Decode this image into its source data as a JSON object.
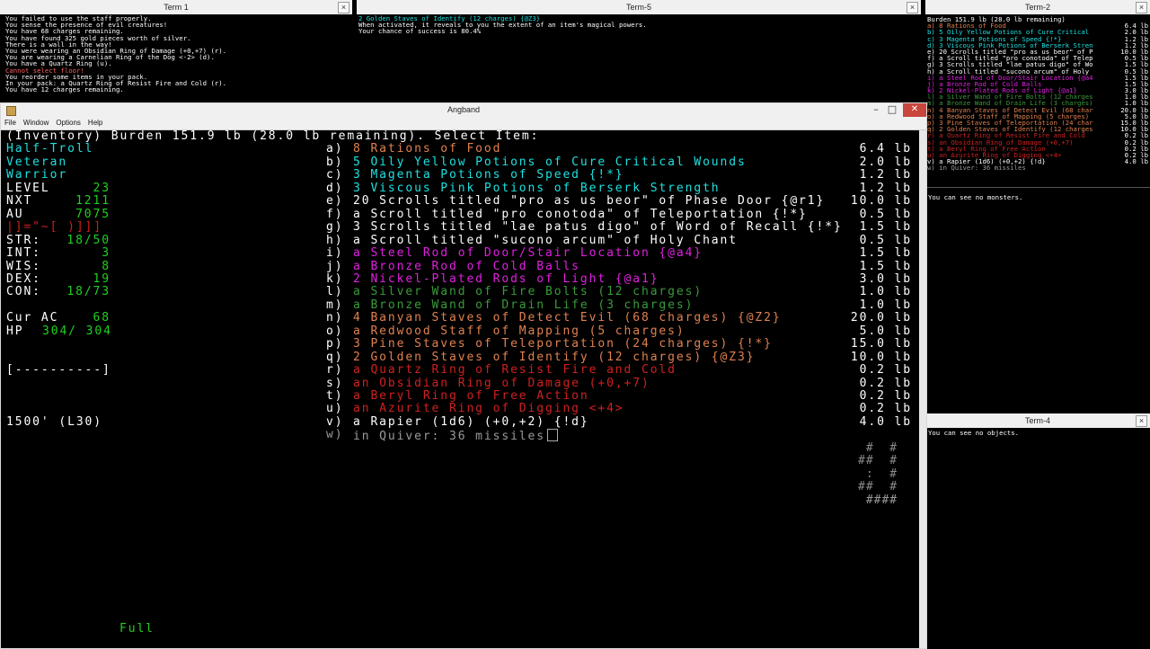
{
  "term1": {
    "title": "Term 1",
    "lines": [
      {
        "text": "You failed to use the staff properly.",
        "color": "#ffffff"
      },
      {
        "text": "You sense the presence of evil creatures!",
        "color": "#ffffff"
      },
      {
        "text": "You have 68 charges remaining.",
        "color": "#ffffff"
      },
      {
        "text": "You have found 325 gold pieces worth of silver.",
        "color": "#ffffff"
      },
      {
        "text": "There is a wall in the way!",
        "color": "#ffffff"
      },
      {
        "text": "You were wearing an Obsidian Ring of Damage (+0,+7) (r).",
        "color": "#ffffff"
      },
      {
        "text": "You are wearing a Carnelian Ring of the Dog <-2> (d).",
        "color": "#ffffff"
      },
      {
        "text": "You have a Quartz Ring (u).",
        "color": "#ffffff"
      },
      {
        "text": "Cannot select floor!",
        "color": "#ff6060"
      },
      {
        "text": "You reorder some items in your pack.",
        "color": "#ffffff"
      },
      {
        "text": "In your pack: a Quartz Ring of Resist Fire and Cold (r).",
        "color": "#ffffff"
      },
      {
        "text": "You have 12 charges remaining.",
        "color": "#ffffff"
      }
    ]
  },
  "term5": {
    "title": "Term-5",
    "lines": [
      {
        "text": "2 Golden Staves of Identify (12 charges) {@Z3}",
        "color": "#1ee0e0"
      },
      {
        "text": "When activated, it reveals to you the extent of an item's magical powers.",
        "color": "#ffffff"
      },
      {
        "text": "Your chance of success is 80.4%",
        "color": "#ffffff"
      }
    ]
  },
  "term2": {
    "title": "Term-2",
    "lines": [
      {
        "text": "Burden 151.9 lb (28.0 lb remaining)",
        "color": "#ffffff",
        "w": ""
      },
      {
        "text": "a) 8 Rations of Food",
        "color": "#e08050",
        "w": "6.4 lb"
      },
      {
        "text": "b) 5 Oily Yellow Potions of Cure Critical",
        "color": "#1ee0e0",
        "w": "2.0 lb"
      },
      {
        "text": "c) 3 Magenta Potions of Speed {!*}",
        "color": "#1ee0e0",
        "w": "1.2 lb"
      },
      {
        "text": "d) 3 Viscous Pink Potions of Berserk Stren",
        "color": "#1ee0e0",
        "w": "1.2 lb"
      },
      {
        "text": "e) 20 Scrolls titled \"pro as us beor\" of P",
        "color": "#ffffff",
        "w": "10.0 lb"
      },
      {
        "text": "f) a Scroll titled \"pro conotoda\" of Telep",
        "color": "#ffffff",
        "w": "0.5 lb"
      },
      {
        "text": "g) 3 Scrolls titled \"lae patus digo\" of Wo",
        "color": "#ffffff",
        "w": "1.5 lb"
      },
      {
        "text": "h) a Scroll titled \"sucono arcum\" of Holy",
        "color": "#ffffff",
        "w": "0.5 lb"
      },
      {
        "text": "i) a Steel Rod of Door/Stair Location {@a4",
        "color": "#e020e0",
        "w": "1.5 lb"
      },
      {
        "text": "j) a Bronze Rod of Cold Balls",
        "color": "#e020e0",
        "w": "1.5 lb"
      },
      {
        "text": "k) 2 Nickel-Plated Rods of Light {@a1}",
        "color": "#e020e0",
        "w": "3.0 lb"
      },
      {
        "text": "l) a Silver Wand of Fire Bolts (12 charges",
        "color": "#3a9a3a",
        "w": "1.0 lb"
      },
      {
        "text": "m) a Bronze Wand of Drain Life (3 charges)",
        "color": "#3a9a3a",
        "w": "1.0 lb"
      },
      {
        "text": "n) 4 Banyan Staves of Detect Evil (68 char",
        "color": "#e08050",
        "w": "20.0 lb"
      },
      {
        "text": "o) a Redwood Staff of Mapping (5 charges)",
        "color": "#e08050",
        "w": "5.0 lb"
      },
      {
        "text": "p) 3 Pine Staves of Teleportation (24 char",
        "color": "#e08050",
        "w": "15.0 lb"
      },
      {
        "text": "q) 2 Golden Staves of Identify (12 charges",
        "color": "#e08050",
        "w": "10.0 lb"
      },
      {
        "text": "r) a Quartz Ring of Resist Fire and Cold",
        "color": "#d02020",
        "w": "0.2 lb"
      },
      {
        "text": "s) an Obsidian Ring of Damage (+0,+7)",
        "color": "#d02020",
        "w": "0.2 lb"
      },
      {
        "text": "t) a Beryl Ring of Free Action",
        "color": "#d02020",
        "w": "0.2 lb"
      },
      {
        "text": "u) an Azurite Ring of Digging <+4>",
        "color": "#d02020",
        "w": "0.2 lb"
      },
      {
        "text": "v) a Rapier (1d6) (+0,+2) {!d}",
        "color": "#ffffff",
        "w": "4.0 lb"
      },
      {
        "text": "w) in Quiver: 36 missiles",
        "color": "#9a9a9a",
        "w": ""
      }
    ],
    "status_text": "You can see no monsters."
  },
  "term4": {
    "title": "Term-4",
    "status_text": "You can see no objects."
  },
  "main": {
    "title": "Angband",
    "menu": [
      "File",
      "Window",
      "Options",
      "Help"
    ],
    "header": "(Inventory) Burden 151.9 lb (28.0 lb remaining). Select Item:",
    "sidebar": {
      "race": "Half-Troll",
      "title": "Veteran",
      "class": "Warrior",
      "level_label": "LEVEL",
      "level": "23",
      "nxt_label": "NXT",
      "nxt": "1211",
      "au_label": "AU",
      "au": "7075",
      "equip": "|]=\"~[ )]]]",
      "str_label": "STR:",
      "str": "18/50",
      "int_label": "INT:",
      "int": "3",
      "wis_label": "WIS:",
      "wis": "8",
      "dex_label": "DEX:",
      "dex": "19",
      "con_label": "CON:",
      "con": "18/73",
      "ac_label": "Cur AC",
      "ac": "68",
      "hp_label": "HP",
      "hp": "304/ 304",
      "bar": "[----------]",
      "depth": "1500' (L30)",
      "full": "Full"
    },
    "items": [
      {
        "key": "a)",
        "name": "8 Rations of Food",
        "color": "#e08050",
        "weight": "6.4 lb"
      },
      {
        "key": "b)",
        "name": "5 Oily Yellow Potions of Cure Critical Wounds",
        "color": "#1ee0e0",
        "weight": "2.0 lb"
      },
      {
        "key": "c)",
        "name": "3 Magenta Potions of Speed {!*}",
        "color": "#1ee0e0",
        "weight": "1.2 lb"
      },
      {
        "key": "d)",
        "name": "3 Viscous Pink Potions of Berserk Strength",
        "color": "#1ee0e0",
        "weight": "1.2 lb"
      },
      {
        "key": "e)",
        "name": "20 Scrolls titled \"pro as us beor\" of Phase Door {@r1}",
        "color": "#ffffff",
        "weight": "10.0 lb"
      },
      {
        "key": "f)",
        "name": "a Scroll titled \"pro conotoda\" of Teleportation {!*}",
        "color": "#ffffff",
        "weight": "0.5 lb"
      },
      {
        "key": "g)",
        "name": "3 Scrolls titled \"lae patus digo\" of Word of Recall {!*}",
        "color": "#ffffff",
        "weight": "1.5 lb"
      },
      {
        "key": "h)",
        "name": "a Scroll titled \"sucono arcum\" of Holy Chant",
        "color": "#ffffff",
        "weight": "0.5 lb"
      },
      {
        "key": "i)",
        "name": "a Steel Rod of Door/Stair Location {@a4}",
        "color": "#e020e0",
        "weight": "1.5 lb"
      },
      {
        "key": "j)",
        "name": "a Bronze Rod of Cold Balls",
        "color": "#e020e0",
        "weight": "1.5 lb"
      },
      {
        "key": "k)",
        "name": "2 Nickel-Plated Rods of Light {@a1}",
        "color": "#e020e0",
        "weight": "3.0 lb"
      },
      {
        "key": "l)",
        "name": "a Silver Wand of Fire Bolts (12 charges)",
        "color": "#3a9a3a",
        "weight": "1.0 lb"
      },
      {
        "key": "m)",
        "name": "a Bronze Wand of Drain Life (3 charges)",
        "color": "#3a9a3a",
        "weight": "1.0 lb"
      },
      {
        "key": "n)",
        "name": "4 Banyan Staves of Detect Evil (68 charges) {@Z2}",
        "color": "#e08050",
        "weight": "20.0 lb"
      },
      {
        "key": "o)",
        "name": "a Redwood Staff of Mapping (5 charges)",
        "color": "#e08050",
        "weight": "5.0 lb"
      },
      {
        "key": "p)",
        "name": "3 Pine Staves of Teleportation (24 charges) {!*}",
        "color": "#e08050",
        "weight": "15.0 lb"
      },
      {
        "key": "q)",
        "name": "2 Golden Staves of Identify (12 charges) {@Z3}",
        "color": "#e08050",
        "weight": "10.0 lb"
      },
      {
        "key": "r)",
        "name": "a Quartz Ring of Resist Fire and Cold",
        "color": "#d02020",
        "weight": "0.2 lb"
      },
      {
        "key": "s)",
        "name": "an Obsidian Ring of Damage (+0,+7)",
        "color": "#d02020",
        "weight": "0.2 lb"
      },
      {
        "key": "t)",
        "name": "a Beryl Ring of Free Action",
        "color": "#d02020",
        "weight": "0.2 lb"
      },
      {
        "key": "u)",
        "name": "an Azurite Ring of Digging <+4>",
        "color": "#d02020",
        "weight": "0.2 lb"
      },
      {
        "key": "v)",
        "name": "a Rapier (1d6) (+0,+2) {!d}",
        "color": "#ffffff",
        "weight": "4.0 lb"
      },
      {
        "key": "w)",
        "name": "in Quiver: 36 missiles",
        "color": "#9a9a9a",
        "weight": ""
      }
    ],
    "map": [
      " #  #",
      "##  #",
      " :  #",
      "##  #",
      " ####"
    ]
  }
}
